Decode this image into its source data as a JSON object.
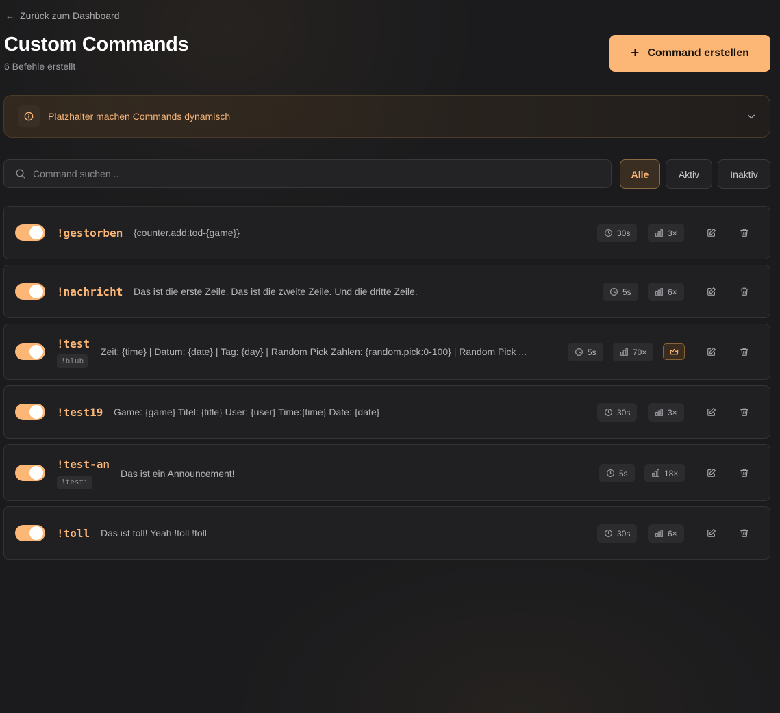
{
  "nav": {
    "back_label": "Zurück zum Dashboard"
  },
  "header": {
    "title": "Custom Commands",
    "subtitle": "6 Befehle erstellt",
    "create_label": "Command erstellen"
  },
  "info": {
    "label": "Platzhalter machen Commands dynamisch"
  },
  "search": {
    "placeholder": "Command suchen..."
  },
  "filters": [
    {
      "label": "Alle",
      "active": true
    },
    {
      "label": "Aktiv",
      "active": false
    },
    {
      "label": "Inaktiv",
      "active": false
    }
  ],
  "colors": {
    "accent": "#fcb676",
    "background": "#1b1b1d",
    "card": "#202022"
  },
  "commands": [
    {
      "name": "!gestorben",
      "alias": "",
      "response": "{counter.add:tod-{game}}",
      "cooldown": "30s",
      "uses": "3×",
      "enabled": true,
      "crown": false
    },
    {
      "name": "!nachricht",
      "alias": "",
      "response": "Das ist die erste Zeile. Das ist die zweite Zeile. Und die dritte Zeile.",
      "cooldown": "5s",
      "uses": "6×",
      "enabled": true,
      "crown": false
    },
    {
      "name": "!test",
      "alias": "!blub",
      "response": "Zeit: {time} | Datum: {date} | Tag: {day} | Random Pick Zahlen: {random.pick:0-100} | Random Pick ...",
      "cooldown": "5s",
      "uses": "70×",
      "enabled": true,
      "crown": true
    },
    {
      "name": "!test19",
      "alias": "",
      "response": "Game: {game} Titel: {title} User: {user} Time:{time} Date: {date}",
      "cooldown": "30s",
      "uses": "3×",
      "enabled": true,
      "crown": false
    },
    {
      "name": "!test-an",
      "alias": "!testi",
      "response": "Das ist ein Announcement!",
      "cooldown": "5s",
      "uses": "18×",
      "enabled": true,
      "crown": false
    },
    {
      "name": "!toll",
      "alias": "",
      "response": "Das ist toll! Yeah !toll !toll",
      "cooldown": "30s",
      "uses": "6×",
      "enabled": true,
      "crown": false
    }
  ]
}
